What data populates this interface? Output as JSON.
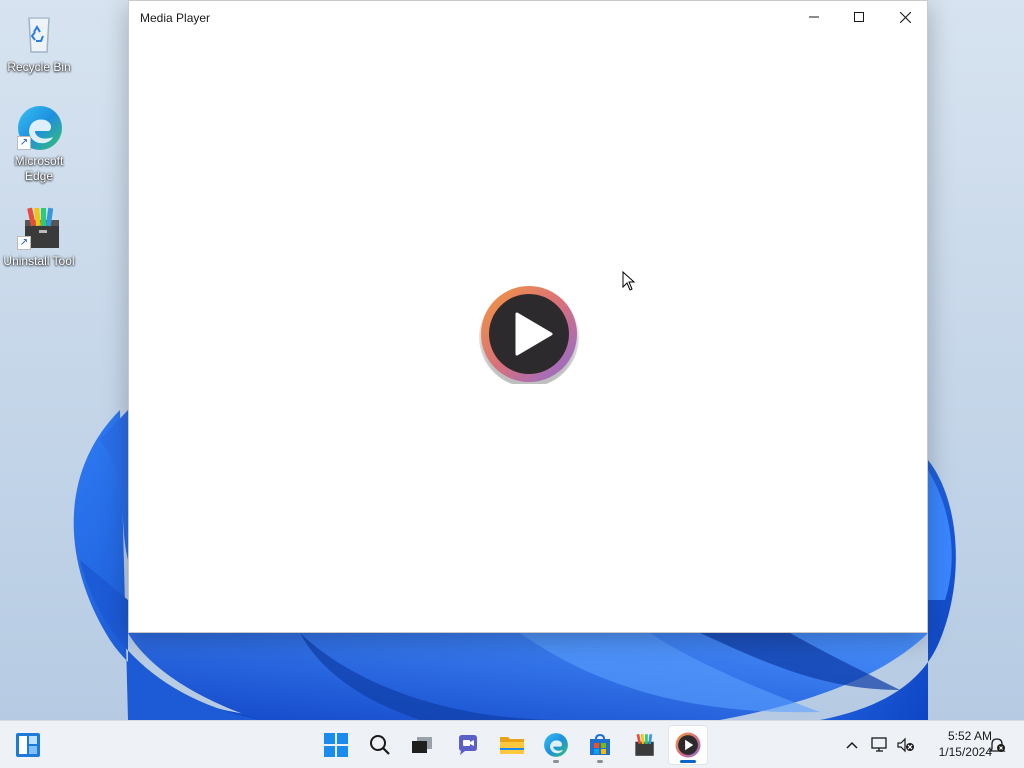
{
  "desktop": {
    "icons": [
      {
        "label": "Recycle Bin",
        "icon": "recycle-bin-icon"
      },
      {
        "label": "Microsoft Edge",
        "icon": "edge-icon"
      },
      {
        "label": "Uninstall Tool",
        "icon": "uninstall-tool-icon"
      }
    ]
  },
  "window": {
    "title": "Media Player",
    "controls": [
      "minimize",
      "maximize",
      "close"
    ],
    "center_button": "play-icon"
  },
  "taskbar": {
    "widgets_icon": "widgets-icon",
    "pinned": [
      {
        "name": "start",
        "icon": "windows-logo-icon"
      },
      {
        "name": "search",
        "icon": "search-icon"
      },
      {
        "name": "task-view",
        "icon": "task-view-icon"
      },
      {
        "name": "chat",
        "icon": "chat-icon"
      },
      {
        "name": "file-explorer",
        "icon": "folder-icon"
      },
      {
        "name": "edge",
        "icon": "edge-icon"
      },
      {
        "name": "store",
        "icon": "store-icon"
      },
      {
        "name": "uninstall-tool",
        "icon": "uninstall-tool-icon"
      },
      {
        "name": "media-player",
        "icon": "media-player-icon"
      }
    ],
    "tray": {
      "overflow_icon": "chevron-up-icon",
      "network_icon": "network-icon",
      "volume_icon": "volume-muted-icon",
      "notification_icon": "notification-icon"
    },
    "clock": {
      "time": "5:52 AM",
      "date": "1/15/2024"
    }
  },
  "colors": {
    "accent": "#0a64c8",
    "wallpaper_base": "#c9d9ec",
    "bloom_blue": "#1f5fe0"
  }
}
